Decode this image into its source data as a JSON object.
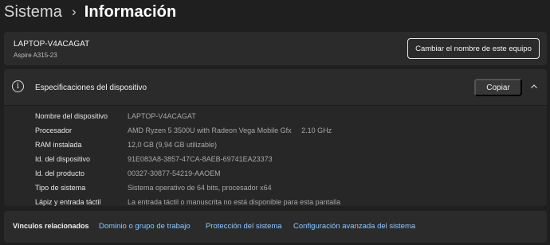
{
  "breadcrumb": {
    "parent": "Sistema",
    "separator": "›",
    "current": "Información"
  },
  "device": {
    "name": "LAPTOP-V4ACAGAT",
    "model": "Aspire A315-23",
    "rename_button": "Cambiar el nombre de este equipo"
  },
  "specs": {
    "title": "Especificaciones del dispositivo",
    "info_icon_glyph": "i",
    "copy_button": "Copiar",
    "rows": [
      {
        "label": "Nombre del dispositivo",
        "value": "LAPTOP-V4ACAGAT"
      },
      {
        "label": "Procesador",
        "value": "AMD Ryzen 5 3500U with Radeon Vega Mobile Gfx     2.10 GHz"
      },
      {
        "label": "RAM instalada",
        "value": "12,0 GB (9,94 GB utilizable)"
      },
      {
        "label": "Id. del dispositivo",
        "value": "91E083A8-3857-47CA-8AEB-69741EA23373"
      },
      {
        "label": "Id. del producto",
        "value": "00327-30877-54219-AAOEM"
      },
      {
        "label": "Tipo de sistema",
        "value": "Sistema operativo de 64 bits, procesador x64"
      },
      {
        "label": "Lápiz y entrada táctil",
        "value": "La entrada táctil o manuscrita no está disponible para esta pantalla"
      }
    ]
  },
  "related": {
    "title": "Vínculos relacionados",
    "links": [
      "Dominio o grupo de trabajo",
      "Protección del sistema",
      "Configuración avanzada del sistema"
    ]
  },
  "colors": {
    "background": "#1f1f1f",
    "card": "#2b2b2b",
    "link": "#8fc8ff"
  }
}
